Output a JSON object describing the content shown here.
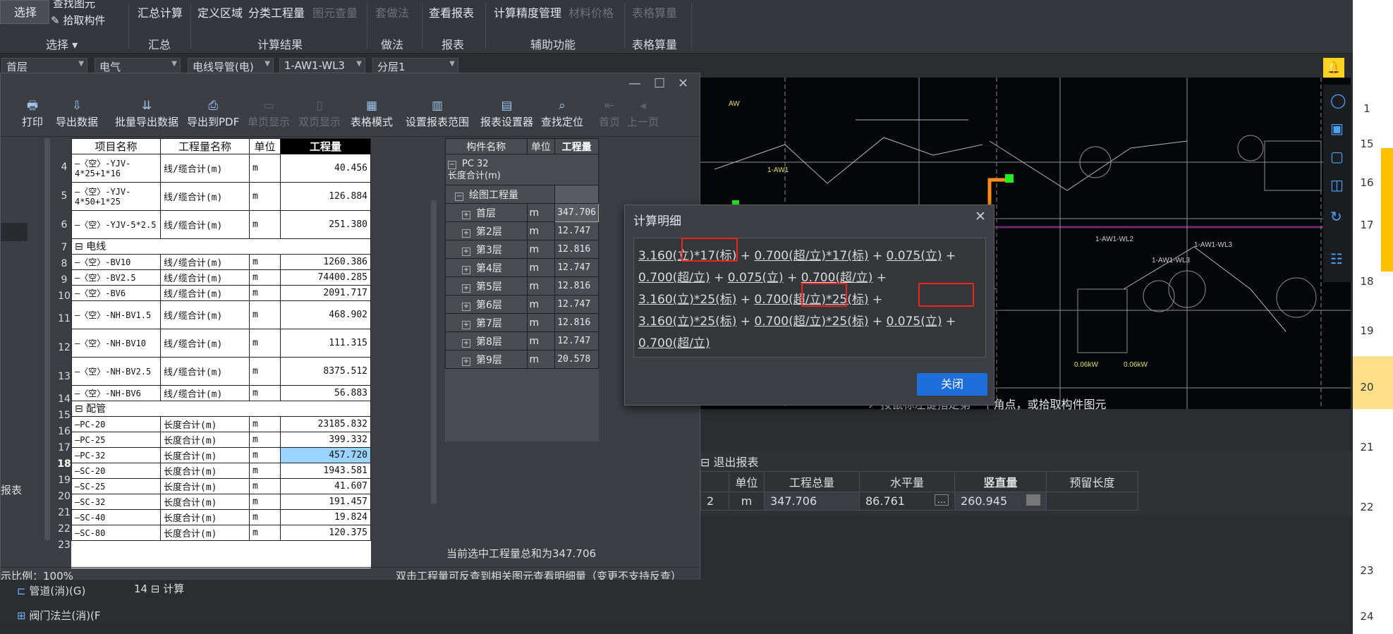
{
  "ribbon": {
    "select": "选择",
    "find_elem": "查找图元",
    "pick_comp": "拾取构件",
    "summary_calc": "汇总计算",
    "define_area": "定义区域",
    "classify_qty": "分类工程量",
    "elem_check": "图元查量",
    "set_method": "套做法",
    "view_report": "查看报表",
    "precision": "计算精度管理",
    "mat_price": "材料价格",
    "table_calc": "表格算量",
    "g_select": "选择 ▾",
    "g_summary": "汇总",
    "g_result": "计算结果",
    "g_method": "做法",
    "g_report": "报表",
    "g_aux": "辅助功能",
    "g_table": "表格算量"
  },
  "toolbar2": {
    "floor": "首层",
    "discipline": "电气",
    "category": "电线导管(电)",
    "component": "1-AW1-WL3",
    "layer": "分层1"
  },
  "report": {
    "tools": [
      {
        "label": "打印",
        "icon": "🖶",
        "dis": false
      },
      {
        "label": "导出数据",
        "icon": "⇩",
        "dis": false
      },
      {
        "label": "批量导出数据",
        "icon": "⇊",
        "dis": false
      },
      {
        "label": "导出到PDF",
        "icon": "⎙",
        "dis": false
      },
      {
        "label": "单页显示",
        "icon": "▭",
        "dis": true
      },
      {
        "label": "双页显示",
        "icon": "▯",
        "dis": true
      },
      {
        "label": "表格模式",
        "icon": "▦",
        "dis": false
      },
      {
        "label": "设置报表范围",
        "icon": "▥",
        "dis": false
      },
      {
        "label": "报表设置器",
        "icon": "▤",
        "dis": false
      },
      {
        "label": "查找定位",
        "icon": "⌕",
        "dis": false
      },
      {
        "label": "首页",
        "icon": "⇤",
        "dis": true
      },
      {
        "label": "上一页",
        "icon": "◂",
        "dis": true
      }
    ],
    "left_headers": [
      "项目名称",
      "工程量名称",
      "单位",
      "工程量"
    ],
    "left_rows": [
      {
        "n": "4",
        "name": "—〈空〉-YJV-4*25+1*16",
        "q": "线/缆合计(m)",
        "u": "m",
        "v": "40.456"
      },
      {
        "n": "5",
        "name": "—〈空〉-YJV-4*50+1*25",
        "q": "线/缆合计(m)",
        "u": "m",
        "v": "126.884"
      },
      {
        "n": "6",
        "name": "—〈空〉-YJV-5*2.5",
        "q": "线/缆合计(m)",
        "u": "m",
        "v": "251.380"
      },
      {
        "n": "7",
        "name": "⊟ 电线",
        "q": "",
        "u": "",
        "v": ""
      },
      {
        "n": "8",
        "name": "—〈空〉-BV10",
        "q": "线/缆合计(m)",
        "u": "m",
        "v": "1260.386"
      },
      {
        "n": "9",
        "name": "—〈空〉-BV2.5",
        "q": "线/缆合计(m)",
        "u": "m",
        "v": "74400.285"
      },
      {
        "n": "10",
        "name": "—〈空〉-BV6",
        "q": "线/缆合计(m)",
        "u": "m",
        "v": "2091.717"
      },
      {
        "n": "11",
        "name": "—〈空〉-NH-BV1.5",
        "q": "线/缆合计(m)",
        "u": "m",
        "v": "468.902"
      },
      {
        "n": "12",
        "name": "—〈空〉-NH-BV10",
        "q": "线/缆合计(m)",
        "u": "m",
        "v": "111.315"
      },
      {
        "n": "13",
        "name": "—〈空〉-NH-BV2.5",
        "q": "线/缆合计(m)",
        "u": "m",
        "v": "8375.512"
      },
      {
        "n": "14",
        "name": "—〈空〉-NH-BV6",
        "q": "线/缆合计(m)",
        "u": "m",
        "v": "56.883"
      },
      {
        "n": "15",
        "name": "⊟ 配管",
        "q": "",
        "u": "",
        "v": ""
      },
      {
        "n": "16",
        "name": "—PC-20",
        "q": "长度合计(m)",
        "u": "m",
        "v": "23185.832"
      },
      {
        "n": "17",
        "name": "—PC-25",
        "q": "长度合计(m)",
        "u": "m",
        "v": "399.332"
      },
      {
        "n": "18",
        "name": "—PC-32",
        "q": "长度合计(m)",
        "u": "m",
        "v": "457.720"
      },
      {
        "n": "19",
        "name": "—SC-20",
        "q": "长度合计(m)",
        "u": "m",
        "v": "1943.581"
      },
      {
        "n": "20",
        "name": "—SC-25",
        "q": "长度合计(m)",
        "u": "m",
        "v": "41.607"
      },
      {
        "n": "21",
        "name": "—SC-32",
        "q": "长度合计(m)",
        "u": "m",
        "v": "191.457"
      },
      {
        "n": "22",
        "name": "—SC-40",
        "q": "长度合计(m)",
        "u": "m",
        "v": "19.824"
      },
      {
        "n": "23",
        "name": "—SC-80",
        "q": "长度合计(m)",
        "u": "m",
        "v": "120.375"
      }
    ],
    "right_headers": [
      "构件名称",
      "单位",
      "工程量"
    ],
    "right_top": "PC 32\n长度合计(m)",
    "right_group": "绘图工程量",
    "right_rows": [
      {
        "name": "首层",
        "u": "m",
        "v": "347.706"
      },
      {
        "name": "第2层",
        "u": "m",
        "v": "12.747"
      },
      {
        "name": "第3层",
        "u": "m",
        "v": "12.816"
      },
      {
        "name": "第4层",
        "u": "m",
        "v": "12.747"
      },
      {
        "name": "第5层",
        "u": "m",
        "v": "12.816"
      },
      {
        "name": "第6层",
        "u": "m",
        "v": "12.747"
      },
      {
        "name": "第7层",
        "u": "m",
        "v": "12.816"
      },
      {
        "name": "第8层",
        "u": "m",
        "v": "12.747"
      },
      {
        "name": "第9层",
        "u": "m",
        "v": "20.578"
      }
    ],
    "selected_total": "当前选中工程量总和为347.706",
    "footer_hint": "双击工程量可反查到相关图元查看明细量（变更不支持反查）",
    "scale": "示比例：100%"
  },
  "dialog": {
    "title": "计算明细",
    "close_label": "关闭",
    "formula_parts": [
      "3.160(立)*17(标)",
      " + ",
      "0.700(超/立)*17(标)",
      " + ",
      "0.075(立)",
      " + ",
      "0.700(超/立)",
      " + ",
      "0.075(立)",
      " + ",
      "0.700(超/立)",
      " + ",
      "3.160(立)*25(标)",
      " + ",
      "0.700(超/立)*25(标)",
      " + ",
      "3.160(立)*25(标)",
      " + ",
      "0.700(超/立)*25(标)",
      " + ",
      "0.075(立)",
      " + ",
      "0.700(超/立)"
    ]
  },
  "cad": {
    "prompt": "按鼠标左键指定第一个角点，或拾取构件图元"
  },
  "props": {
    "exit_report": "退出报表",
    "headers": [
      "单位",
      "工程总量",
      "水平量",
      "竖直量",
      "预留长度"
    ],
    "values": [
      "m",
      "347.706",
      "86.761",
      "260.945",
      ""
    ],
    "row_no": "2"
  },
  "left_panel": {
    "report_label": "报表",
    "pipe_fire": "管道(消)(G)",
    "valve_flange": "阀门法兰(消)(F",
    "calc_row_no": "14",
    "calc_label": "计算"
  },
  "excel_rows": [
    "1",
    "15",
    "16",
    "17",
    "18",
    "19",
    "20",
    "21",
    "22",
    "23",
    "24"
  ],
  "colors": {
    "accent": "#1e6fd9",
    "highlight_red": "#e8271f",
    "orange_pipe": "#ff8c1a",
    "green_node": "#22ee22",
    "selected_cell": "#9bd3ff"
  }
}
